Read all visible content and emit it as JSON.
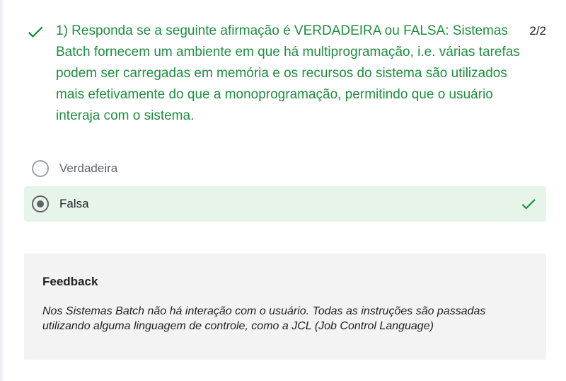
{
  "question": {
    "text": "1) Responda se a seguinte afirmação é VERDADEIRA ou FALSA: Sistemas Batch fornecem um ambiente em que há multiprogramação, i.e. várias tarefas podem ser carregadas em memória e os recursos do sistema são utilizados mais efetivamente do que a monoprogramação, permitindo que o usuário interaja com o sistema.",
    "score": "2/2",
    "status_icon": "check-icon"
  },
  "options": [
    {
      "label": "Verdadeira",
      "selected": false,
      "correct": false
    },
    {
      "label": "Falsa",
      "selected": true,
      "correct": true
    }
  ],
  "feedback": {
    "title": "Feedback",
    "text": "Nos Sistemas Batch não há interação com o usuário. Todas as instruções são passadas utilizando alguma linguagem de controle, como a JCL (Job Control Language)"
  },
  "colors": {
    "correct_green": "#1e8e3e",
    "selected_bg": "#e6f4ea",
    "feedback_bg": "#f3f3f3",
    "radio_gray": "#5f6368"
  }
}
